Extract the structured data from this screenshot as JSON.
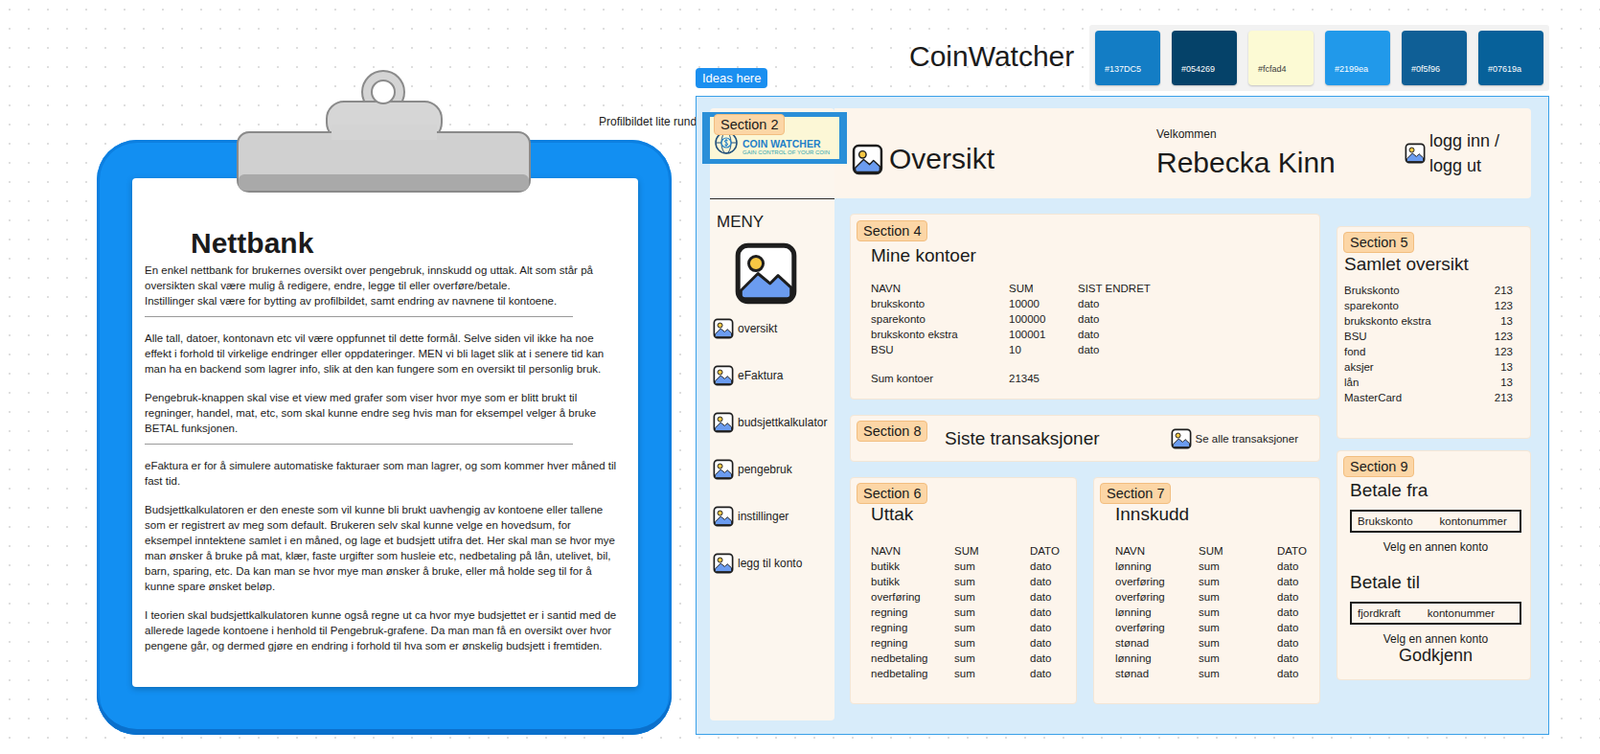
{
  "canvas": {
    "note": "Profilbildet lite rundt",
    "board_title": "CoinWatcher",
    "frame_label": "Ideas here",
    "swatches": [
      {
        "label": "#137DC5",
        "color": "#137dc5"
      },
      {
        "label": "#054269",
        "color": "#054269"
      },
      {
        "label": "#fcfad4",
        "color": "#fcfad4"
      },
      {
        "label": "#2199ea",
        "color": "#2199ea"
      },
      {
        "label": "#0f5f96",
        "color": "#0f5f96"
      },
      {
        "label": "#07619a",
        "color": "#07619a"
      }
    ]
  },
  "clipboard": {
    "title": "Nettbank",
    "blocks": [
      {
        "kind": "paragraph",
        "text": "En enkel nettbank for brukernes oversikt over pengebruk, innskudd og uttak. Alt som står på oversikten skal være mulig å redigere, endre, legge til eller overføre/betale."
      },
      {
        "kind": "continuation",
        "text": "Instillinger skal være for bytting av profilbildet, samt endring av navnene til kontoene."
      },
      {
        "kind": "divider",
        "text": ""
      },
      {
        "kind": "paragraph",
        "text": "Alle tall, datoer, kontonavn etc vil være oppfunnet til dette formål. Selve siden vil ikke ha noe effekt i forhold til virkelige endringer eller oppdateringer. MEN vi bli laget slik at i senere tid kan man ha en backend som lagrer info, slik at den kan fungere som en oversikt til personlig bruk."
      },
      {
        "kind": "paragraph",
        "text": "Pengebruk-knappen skal vise et view med grafer som viser hvor mye som er blitt brukt til regninger, handel, mat, etc, som skal kunne endre seg hvis man for eksempel velger å bruke BETAL funksjonen."
      },
      {
        "kind": "divider",
        "text": ""
      },
      {
        "kind": "paragraph",
        "text": "eFaktura er for å simulere automatiske fakturaer som man lagrer, og som kommer hver måned til fast tid."
      },
      {
        "kind": "paragraph",
        "text": "Budsjettkalkulatoren er den eneste som vil kunne bli brukt uavhengig av kontoene eller tallene som er registrert av meg som default. Brukeren selv skal kunne velge en hovedsum, for eksempel inntektene samlet i en måned, og lage et budsjett utifra det. Her skal man se hvor mye man ønsker å bruke på mat, klær, faste urgifter som husleie etc, nedbetaling på lån, utelivet, bil, barn, sparing, etc. Da kan man se hvor mye man ønsker å bruke, eller må holde seg til for å kunne spare ønsket beløp."
      },
      {
        "kind": "paragraph",
        "text": "I teorien skal budsjettkalkulatoren kunne også regne ut ca hvor mye budsjettet er i santid med de allerede lagede kontoene i henhold til Pengebruk-grafene. Da man man få en oversikt over hvor pengene går, og dermed gjøre en endring i forhold til hva som er ønskelig budsjett i fremtiden."
      }
    ]
  },
  "app": {
    "logo": {
      "badge": "Section 2",
      "name": "COIN WATCHER",
      "tagline": "GAIN CONTROL OF YOUR COIN"
    },
    "menu": {
      "title": "MENY",
      "items": [
        "oversikt",
        "eFaktura",
        "budsjettkalkulator",
        "pengebruk",
        "instillinger",
        "legg til konto"
      ]
    },
    "header": {
      "page_title": "Oversikt",
      "greeting": "Velkommen",
      "user": "Rebecka Kinn",
      "login": "logg inn / logg ut"
    },
    "accounts": {
      "badge": "Section 4",
      "title": "Mine kontoer",
      "columns": [
        "NAVN",
        "SUM",
        "SIST ENDRET"
      ],
      "rows": [
        {
          "name": "brukskonto",
          "sum": "10000",
          "date": "dato"
        },
        {
          "name": "sparekonto",
          "sum": "100000",
          "date": "dato"
        },
        {
          "name": "brukskonto ekstra",
          "sum": "100001",
          "date": "dato"
        },
        {
          "name": "BSU",
          "sum": "10",
          "date": "dato"
        }
      ],
      "total": {
        "label": "Sum kontoer",
        "value": "21345"
      }
    },
    "summary": {
      "badge": "Section 5",
      "title": "Samlet oversikt",
      "rows": [
        {
          "name": "Brukskonto",
          "value": "213"
        },
        {
          "name": "sparekonto",
          "value": "123"
        },
        {
          "name": "brukskonto ekstra",
          "value": "13"
        },
        {
          "name": "BSU",
          "value": "123"
        },
        {
          "name": "fond",
          "value": "123"
        },
        {
          "name": "aksjer",
          "value": "13"
        },
        {
          "name": "lån",
          "value": "13"
        },
        {
          "name": "MasterCard",
          "value": "213"
        }
      ]
    },
    "recent": {
      "badge": "Section 8",
      "title": "Siste transaksjoner",
      "link": "Se alle transaksjoner"
    },
    "withdrawals": {
      "badge": "Section 6",
      "title": "Uttak",
      "columns": [
        "NAVN",
        "SUM",
        "DATO"
      ],
      "rows": [
        {
          "name": "butikk",
          "sum": "sum",
          "date": "dato"
        },
        {
          "name": "butikk",
          "sum": "sum",
          "date": "dato"
        },
        {
          "name": "overføring",
          "sum": "sum",
          "date": "dato"
        },
        {
          "name": "regning",
          "sum": "sum",
          "date": "dato"
        },
        {
          "name": "regning",
          "sum": "sum",
          "date": "dato"
        },
        {
          "name": "regning",
          "sum": "sum",
          "date": "dato"
        },
        {
          "name": "nedbetaling",
          "sum": "sum",
          "date": "dato"
        },
        {
          "name": "nedbetaling",
          "sum": "sum",
          "date": "dato"
        }
      ]
    },
    "deposits": {
      "badge": "Section 7",
      "title": "Innskudd",
      "columns": [
        "NAVN",
        "SUM",
        "DATO"
      ],
      "rows": [
        {
          "name": "lønning",
          "sum": "sum",
          "date": "dato"
        },
        {
          "name": "overføring",
          "sum": "sum",
          "date": "dato"
        },
        {
          "name": "overføring",
          "sum": "sum",
          "date": "dato"
        },
        {
          "name": "lønning",
          "sum": "sum",
          "date": "dato"
        },
        {
          "name": "overføring",
          "sum": "sum",
          "date": "dato"
        },
        {
          "name": "stønad",
          "sum": "sum",
          "date": "dato"
        },
        {
          "name": "lønning",
          "sum": "sum",
          "date": "dato"
        },
        {
          "name": "stønad",
          "sum": "sum",
          "date": "dato"
        }
      ]
    },
    "payment": {
      "badge": "Section 9",
      "from_title": "Betale fra",
      "from": {
        "account": "Brukskonto",
        "number": "kontonummer"
      },
      "from_other": "Velg en annen konto",
      "to_title": "Betale til",
      "to": {
        "account": "fjordkraft",
        "number": "kontonummer"
      },
      "to_other": "Velg en annen konto",
      "confirm": "Godkjenn"
    }
  }
}
